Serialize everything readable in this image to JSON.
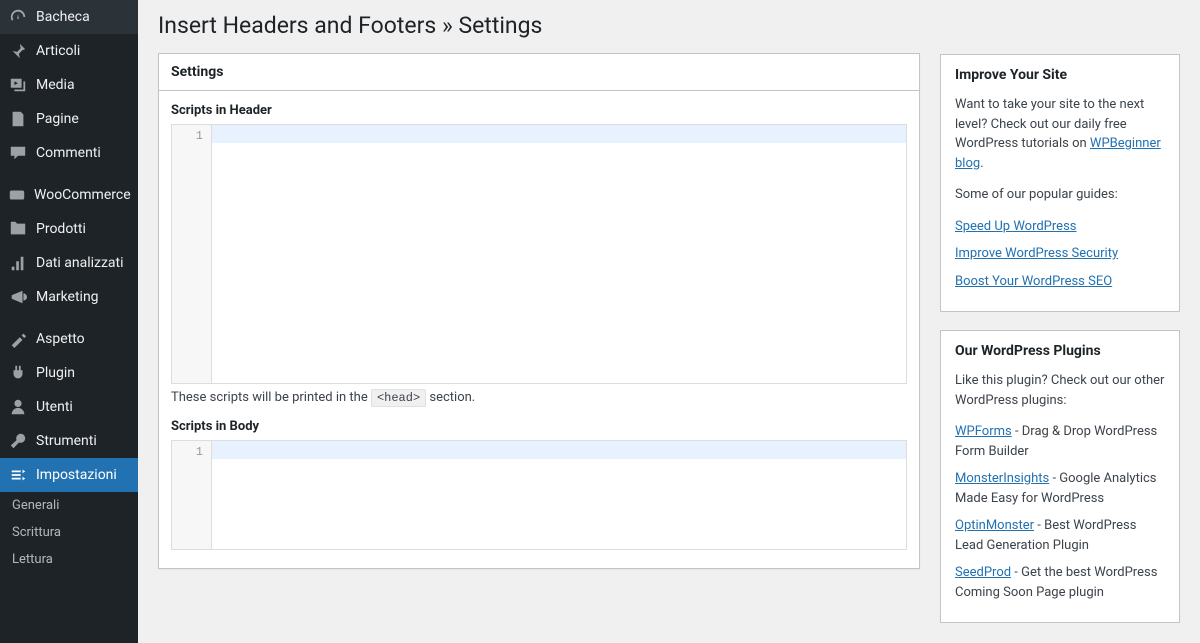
{
  "sidebar": [
    {
      "label": "Bacheca",
      "icon": "dashboard"
    },
    {
      "label": "Articoli",
      "icon": "pin"
    },
    {
      "label": "Media",
      "icon": "media"
    },
    {
      "label": "Pagine",
      "icon": "pages"
    },
    {
      "label": "Commenti",
      "icon": "comments"
    },
    {
      "sep": true
    },
    {
      "label": "WooCommerce",
      "icon": "woo"
    },
    {
      "label": "Prodotti",
      "icon": "products"
    },
    {
      "label": "Dati analizzati",
      "icon": "analytics"
    },
    {
      "label": "Marketing",
      "icon": "marketing"
    },
    {
      "sep": true
    },
    {
      "label": "Aspetto",
      "icon": "appearance"
    },
    {
      "label": "Plugin",
      "icon": "plugin"
    },
    {
      "label": "Utenti",
      "icon": "users"
    },
    {
      "label": "Strumenti",
      "icon": "tools"
    },
    {
      "label": "Impostazioni",
      "icon": "settings",
      "current": true
    }
  ],
  "submenu": [
    "Generali",
    "Scrittura",
    "Lettura"
  ],
  "pageTitle": "Insert Headers and Footers » Settings",
  "settings": {
    "boxTitle": "Settings",
    "headerLabel": "Scripts in Header",
    "headerHelpPre": "These scripts will be printed in the ",
    "headerHelpTag": "<head>",
    "headerHelpPost": " section.",
    "bodyLabel": "Scripts in Body",
    "lineNum": "1"
  },
  "improve": {
    "title": "Improve Your Site",
    "introPre": "Want to take your site to the next level? Check out our daily free WordPress tutorials on ",
    "introLink": "WPBeginner blog",
    "introPost": ".",
    "guidesLabel": "Some of our popular guides:",
    "guides": [
      "Speed Up WordPress",
      "Improve WordPress Security",
      "Boost Your WordPress SEO"
    ]
  },
  "plugins": {
    "title": "Our WordPress Plugins",
    "intro": "Like this plugin? Check out our other WordPress plugins:",
    "items": [
      {
        "name": "WPForms",
        "desc": " - Drag & Drop WordPress Form Builder"
      },
      {
        "name": "MonsterInsights",
        "desc": " - Google Analytics Made Easy for WordPress"
      },
      {
        "name": "OptinMonster",
        "desc": " - Best WordPress Lead Generation Plugin"
      },
      {
        "name": "SeedProd",
        "desc": " - Get the best WordPress Coming Soon Page plugin"
      }
    ]
  }
}
